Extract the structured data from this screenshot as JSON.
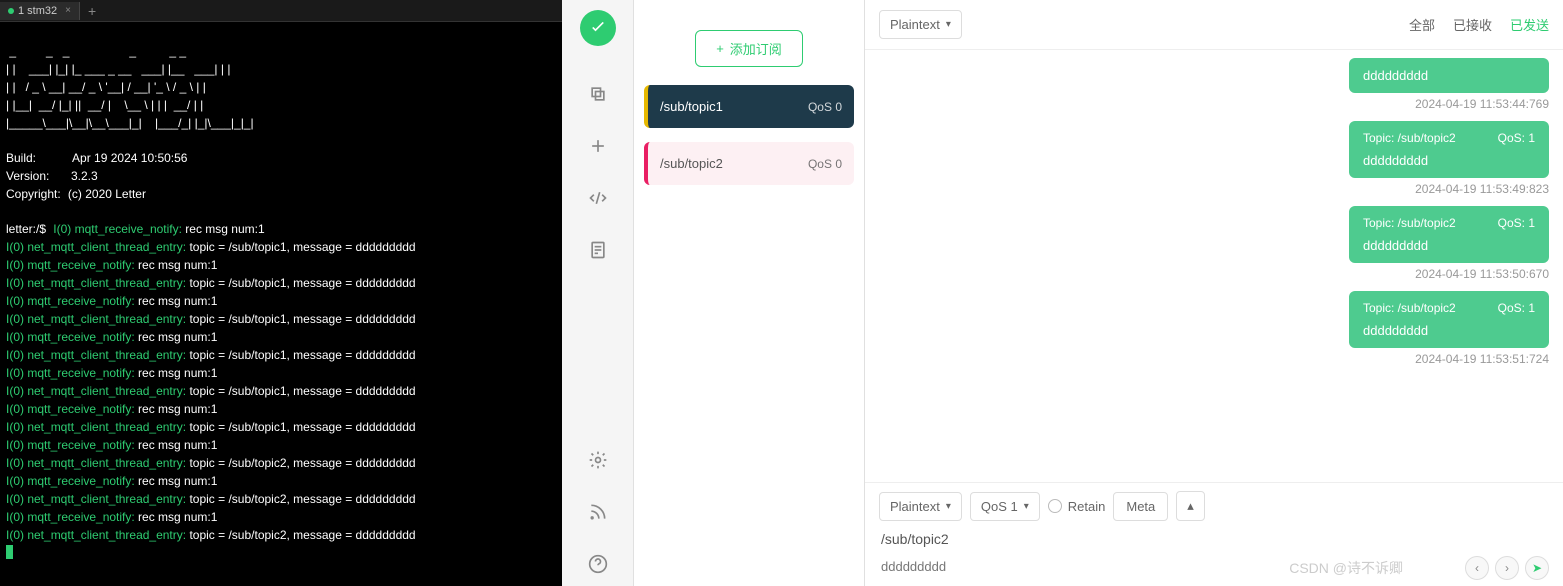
{
  "terminal": {
    "tab": {
      "label": "1 stm32"
    },
    "ascii": " _         _   _                  _          _ _\n| |    ___| |_| |_ ___ _ __   ___| |__   ___| | |\n| |   / _ \\ __| __/ _ \\ '__| / __| '_ \\ / _ \\ | |\n| |__|  __/ |_| ||  __/ |    \\__ \\ | | |  __/ | |\n|_____\\___|\\__|\\__\\___|_|    |___/_| |_|\\___|_|_|",
    "build_label": "Build:",
    "build_value": "Apr 19 2024 10:50:56",
    "version_label": "Version:",
    "version_value": "3.2.3",
    "copyright_label": "Copyright:",
    "copyright_value": "(c) 2020 Letter",
    "prompt": "letter:/$",
    "lines": [
      {
        "prefix": "I(0) mqtt_receive_notify:",
        "msg": " rec msg num:1"
      },
      {
        "prefix": "I(0) net_mqtt_client_thread_entry:",
        "msg": " topic = /sub/topic1, message = ddddddddd"
      },
      {
        "prefix": "I(0) mqtt_receive_notify:",
        "msg": " rec msg num:1"
      },
      {
        "prefix": "I(0) net_mqtt_client_thread_entry:",
        "msg": " topic = /sub/topic1, message = ddddddddd"
      },
      {
        "prefix": "I(0) mqtt_receive_notify:",
        "msg": " rec msg num:1"
      },
      {
        "prefix": "I(0) net_mqtt_client_thread_entry:",
        "msg": " topic = /sub/topic1, message = ddddddddd"
      },
      {
        "prefix": "I(0) mqtt_receive_notify:",
        "msg": " rec msg num:1"
      },
      {
        "prefix": "I(0) net_mqtt_client_thread_entry:",
        "msg": " topic = /sub/topic1, message = ddddddddd"
      },
      {
        "prefix": "I(0) mqtt_receive_notify:",
        "msg": " rec msg num:1"
      },
      {
        "prefix": "I(0) net_mqtt_client_thread_entry:",
        "msg": " topic = /sub/topic1, message = ddddddddd"
      },
      {
        "prefix": "I(0) mqtt_receive_notify:",
        "msg": " rec msg num:1"
      },
      {
        "prefix": "I(0) net_mqtt_client_thread_entry:",
        "msg": " topic = /sub/topic1, message = ddddddddd"
      },
      {
        "prefix": "I(0) mqtt_receive_notify:",
        "msg": " rec msg num:1"
      },
      {
        "prefix": "I(0) net_mqtt_client_thread_entry:",
        "msg": " topic = /sub/topic2, message = ddddddddd"
      },
      {
        "prefix": "I(0) mqtt_receive_notify:",
        "msg": " rec msg num:1"
      },
      {
        "prefix": "I(0) net_mqtt_client_thread_entry:",
        "msg": " topic = /sub/topic2, message = ddddddddd"
      },
      {
        "prefix": "I(0) mqtt_receive_notify:",
        "msg": " rec msg num:1"
      },
      {
        "prefix": "I(0) net_mqtt_client_thread_entry:",
        "msg": " topic = /sub/topic2, message = ddddddddd"
      }
    ]
  },
  "subscribe": {
    "add_label": "添加订阅",
    "items": [
      {
        "topic": "/sub/topic1",
        "qos": "QoS 0",
        "active": true
      },
      {
        "topic": "/sub/topic2",
        "qos": "QoS 0",
        "active": false
      }
    ]
  },
  "messages": {
    "format_dropdown": "Plaintext",
    "filters": {
      "all": "全部",
      "received": "已接收",
      "sent": "已发送"
    },
    "list": [
      {
        "topic": "",
        "qos": "",
        "body": "ddddddddd",
        "time": "2024-04-19 11:53:44:769",
        "header": false
      },
      {
        "topic": "Topic: /sub/topic2",
        "qos": "QoS: 1",
        "body": "ddddddddd",
        "time": "2024-04-19 11:53:49:823",
        "header": true
      },
      {
        "topic": "Topic: /sub/topic2",
        "qos": "QoS: 1",
        "body": "ddddddddd",
        "time": "2024-04-19 11:53:50:670",
        "header": true
      },
      {
        "topic": "Topic: /sub/topic2",
        "qos": "QoS: 1",
        "body": "ddddddddd",
        "time": "2024-04-19 11:53:51:724",
        "header": true
      }
    ],
    "input": {
      "format": "Plaintext",
      "qos": "QoS 1",
      "retain": "Retain",
      "meta": "Meta",
      "topic": "/sub/topic2",
      "payload": "ddddddddd"
    }
  },
  "watermark": "CSDN @诗不诉卿"
}
